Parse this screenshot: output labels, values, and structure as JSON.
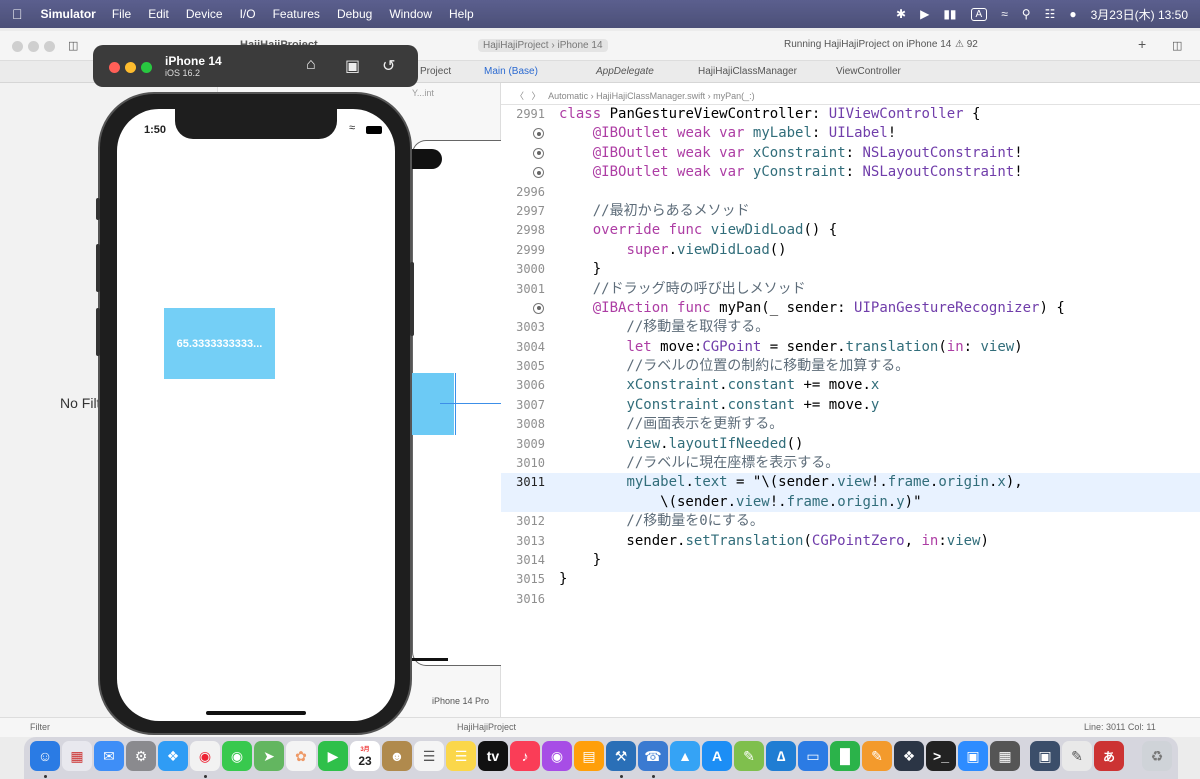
{
  "menubar": {
    "app_name": "Simulator",
    "items": [
      "File",
      "Edit",
      "Device",
      "I/O",
      "Features",
      "Debug",
      "Window",
      "Help"
    ],
    "input_method": "A",
    "datetime": "3月23日(木) 13:50"
  },
  "xcode": {
    "toolbar": {
      "project": "HajiHajiProject",
      "scheme_project": "HajiHajiProject",
      "scheme_device": "iPhone 14",
      "status": "Running HajiHajiProject on iPhone 14",
      "warning_count": "92"
    },
    "tabs": [
      {
        "label": "Project"
      },
      {
        "label": "Main (Base)"
      },
      {
        "label": "AppDelegate"
      },
      {
        "label": "HajiHajiClassManager"
      },
      {
        "label": "ViewController"
      }
    ],
    "jumpbar": {
      "automatic": "Automatic",
      "file": "HajiHajiClassManager.swift",
      "symbol": "myPan(_:)"
    },
    "ib_toolbar": "Y...int",
    "navigator": {
      "no_filter": "No Filter",
      "filter_placeholder": "Filter"
    },
    "ib_device_label": "iPhone 14 Pro",
    "statusbar": {
      "project": "HajiHajiProject",
      "position": "Line: 3011  Col: 11"
    }
  },
  "code_lines": [
    {
      "n": "2991",
      "t": "class PanGestureViewController: UIViewController {"
    },
    {
      "n": "",
      "t": "    @IBOutlet weak var myLabel: UILabel!",
      "bp": true
    },
    {
      "n": "",
      "t": "    @IBOutlet weak var xConstraint: NSLayoutConstraint!",
      "bp": true
    },
    {
      "n": "",
      "t": "    @IBOutlet weak var yConstraint: NSLayoutConstraint!",
      "bp": true
    },
    {
      "n": "2996",
      "t": ""
    },
    {
      "n": "2997",
      "t": "    //最初からあるメソッド"
    },
    {
      "n": "2998",
      "t": "    override func viewDidLoad() {"
    },
    {
      "n": "2999",
      "t": "        super.viewDidLoad()"
    },
    {
      "n": "3000",
      "t": "    }"
    },
    {
      "n": "3001",
      "t": "    //ドラッグ時の呼び出しメソッド"
    },
    {
      "n": "",
      "t": "    @IBAction func myPan(_ sender: UIPanGestureRecognizer) {",
      "bp": true
    },
    {
      "n": "3003",
      "t": "        //移動量を取得する。"
    },
    {
      "n": "3004",
      "t": "        let move:CGPoint = sender.translation(in: view)"
    },
    {
      "n": "3005",
      "t": "        //ラベルの位置の制約に移動量を加算する。"
    },
    {
      "n": "3006",
      "t": "        xConstraint.constant += move.x"
    },
    {
      "n": "3007",
      "t": "        yConstraint.constant += move.y"
    },
    {
      "n": "3008",
      "t": "        //画面表示を更新する。"
    },
    {
      "n": "3009",
      "t": "        view.layoutIfNeeded()"
    },
    {
      "n": "3010",
      "t": "        //ラベルに現在座標を表示する。"
    },
    {
      "n": "3011",
      "t": "        myLabel.text = \"\\(sender.view!.frame.origin.x),",
      "active": true
    },
    {
      "n": "",
      "t": "            \\(sender.view!.frame.origin.y)\"",
      "active": true
    },
    {
      "n": "3012",
      "t": "        //移動量を0にする。"
    },
    {
      "n": "3013",
      "t": "        sender.setTranslation(CGPointZero, in:view)"
    },
    {
      "n": "3014",
      "t": "    }"
    },
    {
      "n": "3015",
      "t": "}"
    },
    {
      "n": "3016",
      "t": ""
    }
  ],
  "simulator": {
    "device_name": "iPhone 14",
    "os_version": "iOS 16.2",
    "status_time": "1:50",
    "label_text": "65.3333333333..."
  },
  "dock": {
    "calendar_month": "3月",
    "calendar_day": "23"
  }
}
